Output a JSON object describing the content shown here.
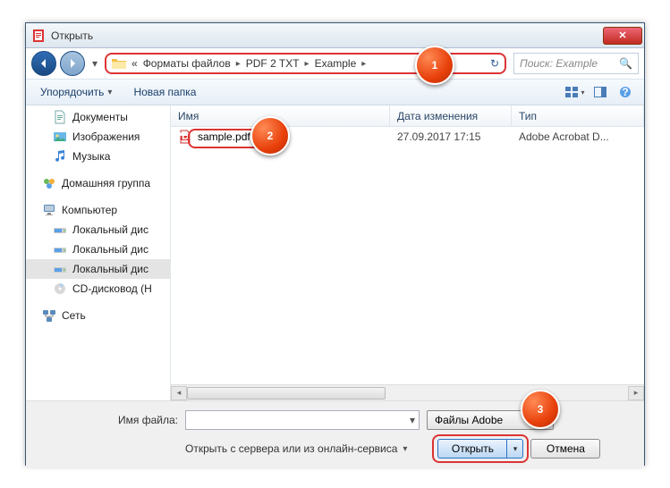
{
  "window": {
    "title": "Открыть"
  },
  "breadcrumbs": {
    "prefix": "«",
    "b1": "Форматы файлов",
    "b2": "PDF 2 TXT",
    "b3": "Example"
  },
  "search": {
    "placeholder": "Поиск: Example"
  },
  "toolbar": {
    "organize": "Упорядочить",
    "new_folder": "Новая папка"
  },
  "sidebar": {
    "docs": "Документы",
    "images": "Изображения",
    "music": "Музыка",
    "homegroup": "Домашняя группа",
    "computer": "Компьютер",
    "disk1": "Локальный дис",
    "disk2": "Локальный дис",
    "disk3": "Локальный дис",
    "cd": "CD-дисковод (H",
    "network": "Сеть"
  },
  "columns": {
    "name": "Имя",
    "date": "Дата изменения",
    "type": "Тип"
  },
  "file": {
    "name": "sample.pdf",
    "date": "27.09.2017 17:15",
    "type": "Adobe Acrobat D..."
  },
  "footer": {
    "filename_label": "Имя файла:",
    "filename_value": "",
    "filter": "Файлы Adobe",
    "server_link": "Открыть с сервера или из онлайн-сервиса",
    "open": "Открыть",
    "cancel": "Отмена"
  },
  "callouts": {
    "c1": "1",
    "c2": "2",
    "c3": "3"
  }
}
